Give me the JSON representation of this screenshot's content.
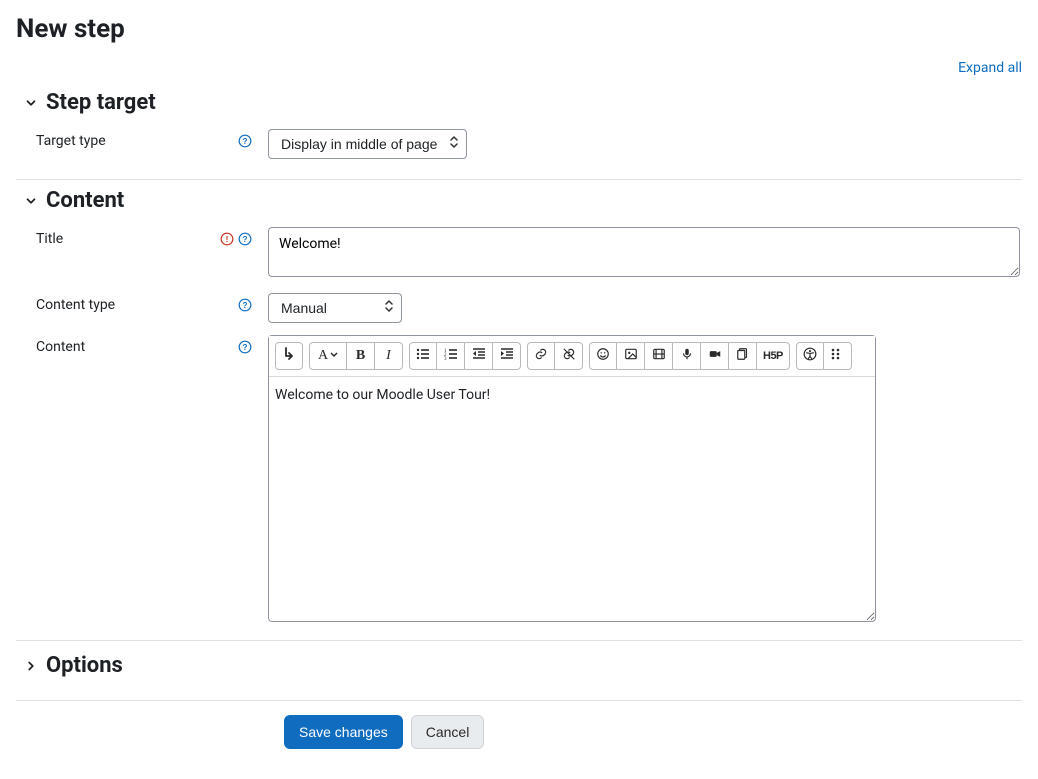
{
  "page": {
    "title": "New step",
    "expand_all": "Expand all"
  },
  "sections": {
    "step_target": {
      "heading": "Step target",
      "target_type_label": "Target type",
      "target_type_value": "Display in middle of page"
    },
    "content": {
      "heading": "Content",
      "title_label": "Title",
      "title_value": "Welcome!",
      "content_type_label": "Content type",
      "content_type_value": "Manual",
      "content_label": "Content",
      "body_text": "Welcome to our Moodle User Tour!"
    },
    "options": {
      "heading": "Options"
    }
  },
  "buttons": {
    "save": "Save changes",
    "cancel": "Cancel"
  },
  "toolbar": {
    "h5p": "H5P"
  }
}
